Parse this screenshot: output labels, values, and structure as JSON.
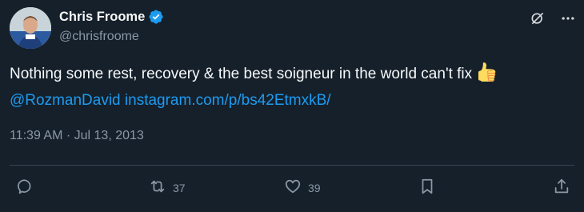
{
  "author": {
    "display_name": "Chris Froome",
    "handle": "@chrisfroome"
  },
  "tweet": {
    "text": "Nothing some rest, recovery & the best soigneur in the world can't fix",
    "emoji": "👍",
    "mention": "@RozmanDavid",
    "link": "instagram.com/p/bs42EtmxkB/"
  },
  "timestamp": "11:39 AM · Jul 13, 2013",
  "actions": {
    "retweets": "37",
    "likes": "39"
  },
  "colors": {
    "background": "#15202b",
    "accent": "#1d9bf0",
    "muted": "#8b98a5",
    "divider": "#38444d"
  },
  "icons": [
    "verified-badge-icon",
    "grok-icon",
    "more-icon",
    "reply-icon",
    "retweet-icon",
    "like-icon",
    "bookmark-icon",
    "share-icon"
  ]
}
